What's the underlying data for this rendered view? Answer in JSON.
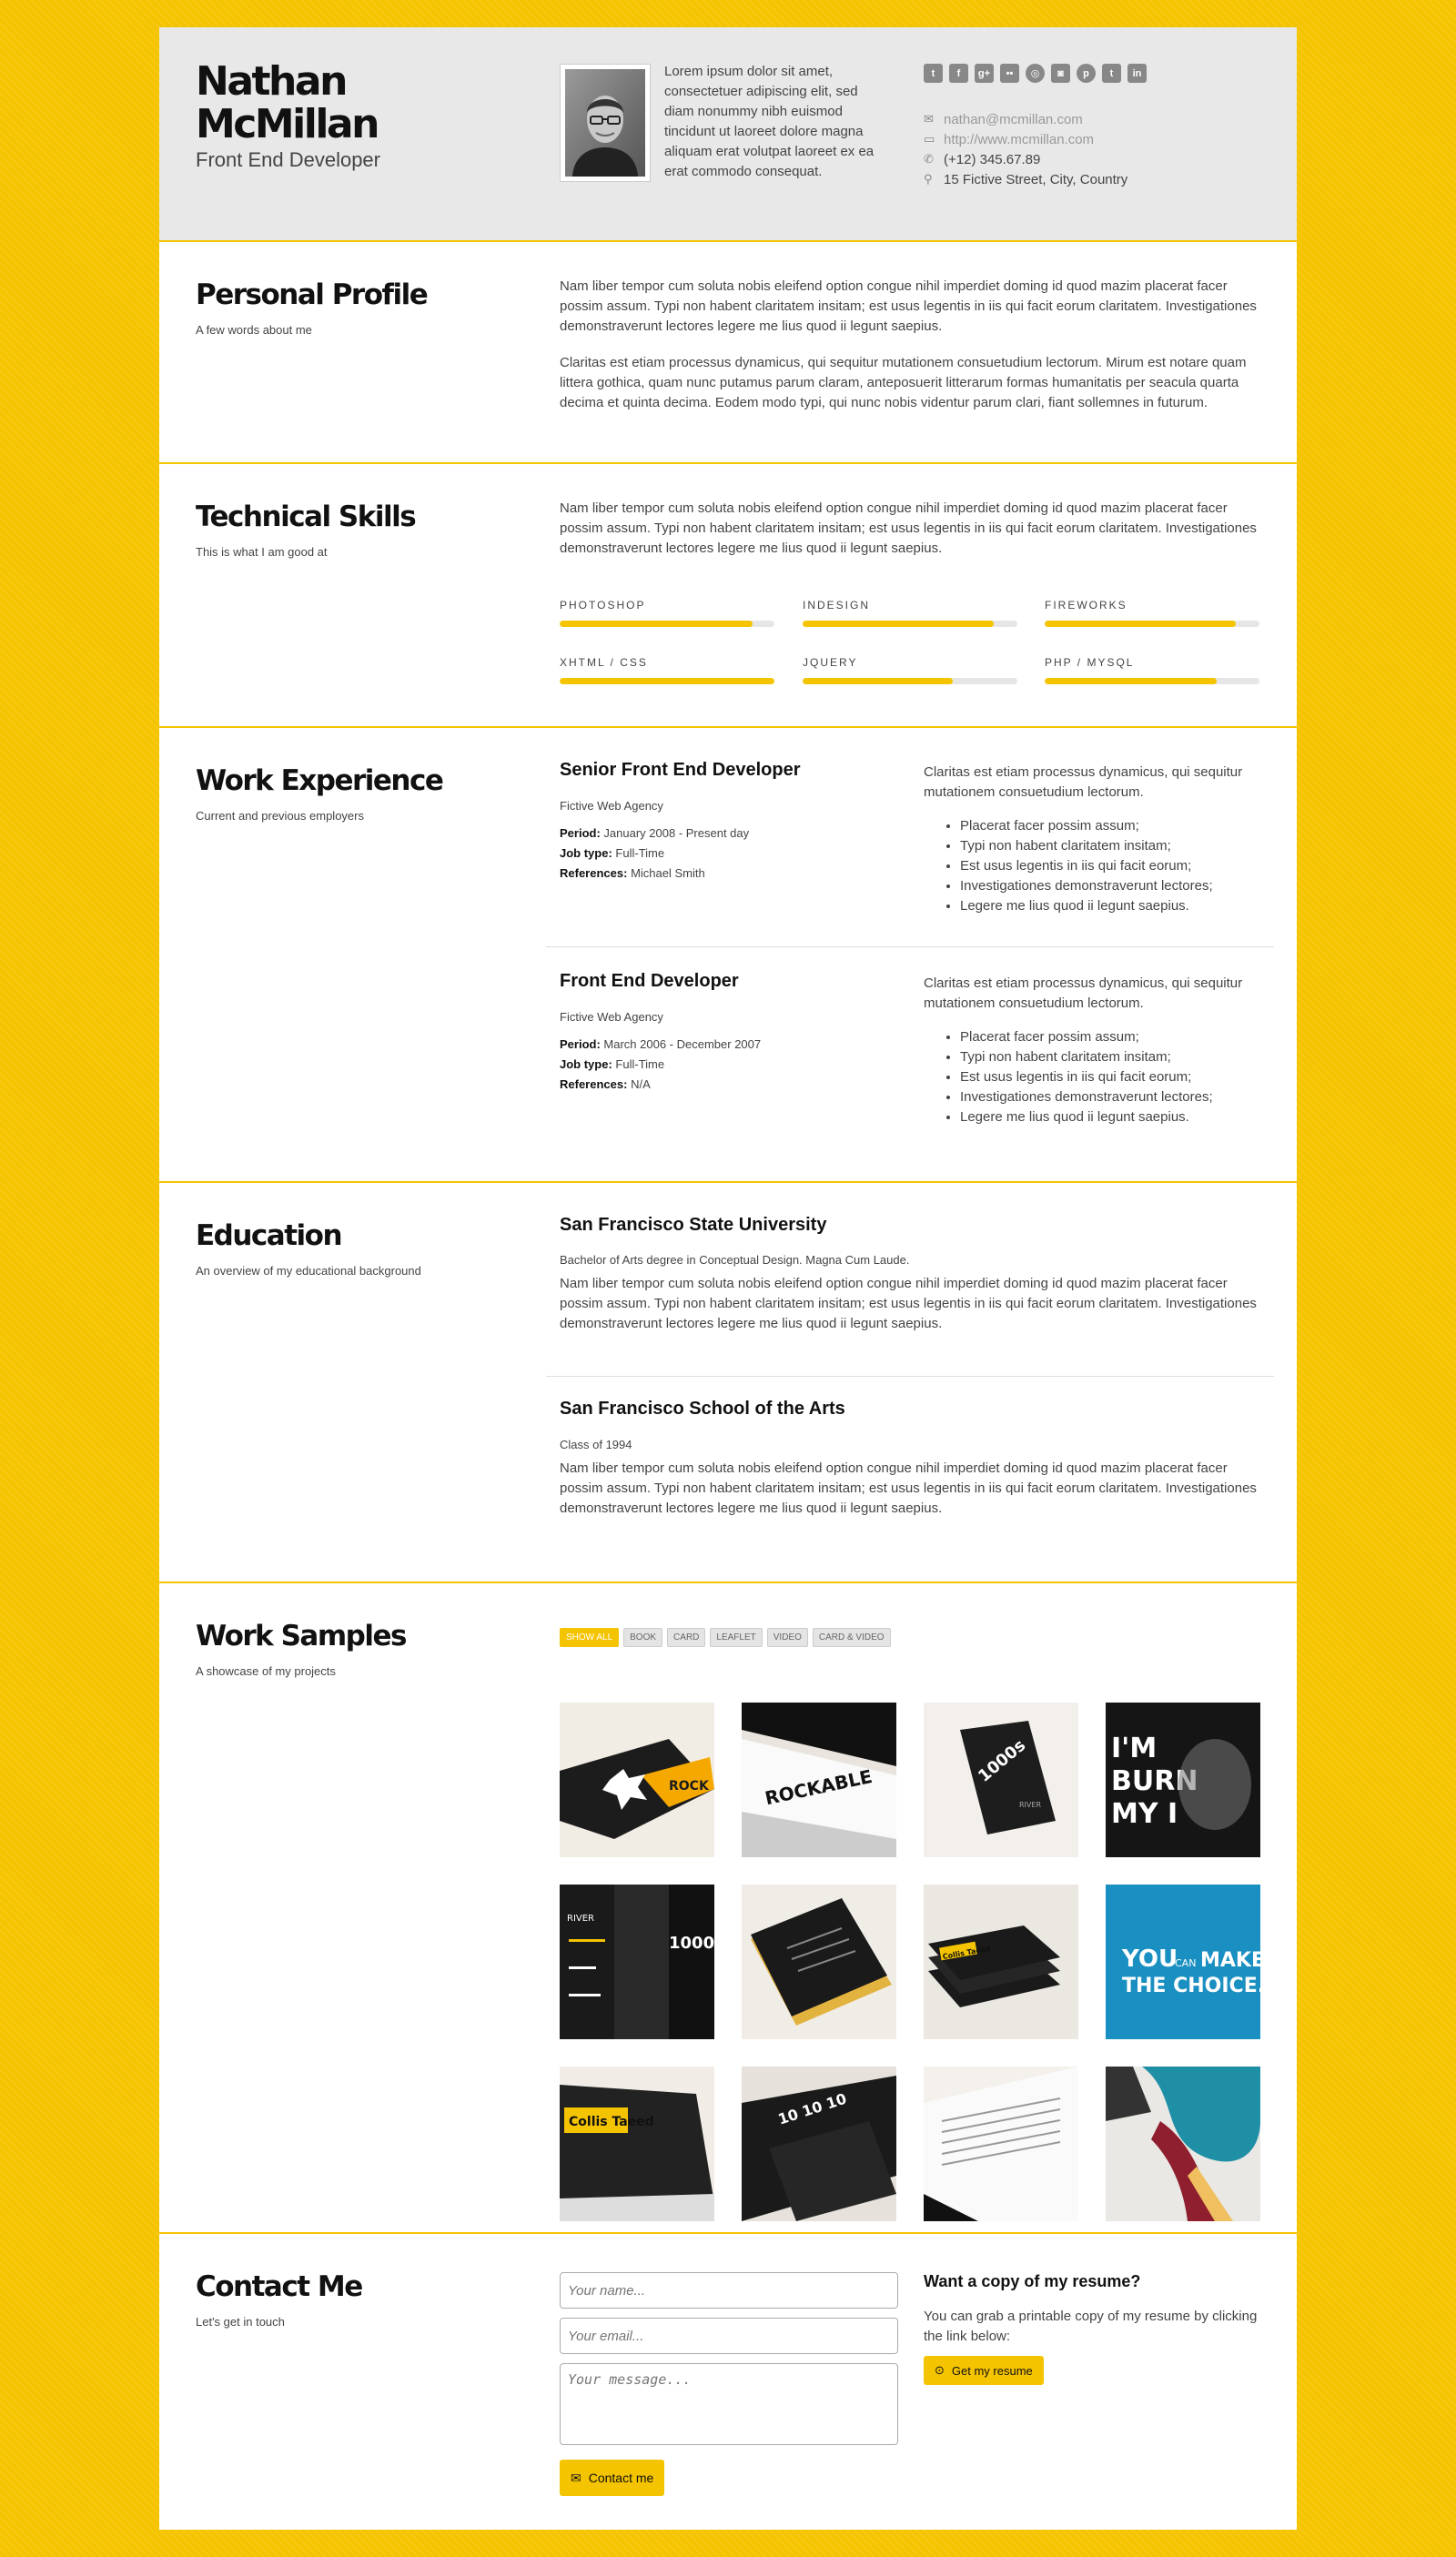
{
  "colors": {
    "accent": "#f5c400",
    "header_bg": "#e8e8e8"
  },
  "header": {
    "name": "Nathan McMillan",
    "role": "Front End Developer",
    "intro": "Lorem ipsum dolor sit amet, consectetuer adipiscing elit, sed diam nonummy nibh euismod tincidunt ut laoreet dolore magna aliquam erat volutpat laoreet ex ea erat commodo consequat.",
    "social_icons": [
      "twitter-icon",
      "facebook-icon",
      "google-plus-icon",
      "flickr-icon",
      "dribbble-icon",
      "instagram-icon",
      "pinterest-icon",
      "tumblr-icon",
      "linkedin-icon"
    ],
    "email": "nathan@mcmillan.com",
    "website": "http://www.mcmillan.com",
    "phone": "(+12) 345.67.89",
    "address": "15 Fictive Street, City, Country"
  },
  "profile": {
    "title": "Personal Profile",
    "subtitle": "A few words about me",
    "p1": "Nam liber tempor cum soluta nobis eleifend option congue nihil imperdiet doming id quod mazim placerat facer possim assum. Typi non habent claritatem insitam; est usus legentis in iis qui facit eorum claritatem. Investigationes demonstraverunt lectores legere me lius quod ii legunt saepius.",
    "p2": "Claritas est etiam processus dynamicus, qui sequitur mutationem consuetudium lectorum. Mirum est notare quam littera gothica, quam nunc putamus parum claram, anteposuerit litterarum formas humanitatis per seacula quarta decima et quinta decima. Eodem modo typi, qui nunc nobis videntur parum clari, fiant sollemnes in futurum."
  },
  "skills": {
    "title": "Technical Skills",
    "subtitle": "This is what I am good at",
    "text": "Nam liber tempor cum soluta nobis eleifend option congue nihil imperdiet doming id quod mazim placerat facer possim assum. Typi non habent claritatem insitam; est usus legentis in iis qui facit eorum claritatem. Investigationes demonstraverunt lectores legere me lius quod ii legunt saepius.",
    "items": [
      {
        "label": "PHOTOSHOP",
        "level": 0.9
      },
      {
        "label": "INDESIGN",
        "level": 0.89
      },
      {
        "label": "FIREWORKS",
        "level": 0.89
      },
      {
        "label": "XHTML / CSS",
        "level": 1.0
      },
      {
        "label": "JQUERY",
        "level": 0.7
      },
      {
        "label": "PHP / MYSQL",
        "level": 0.8
      }
    ]
  },
  "work": {
    "title": "Work Experience",
    "subtitle": "Current and previous employers",
    "period_label": "Period:",
    "jobtype_label": "Job type:",
    "refs_label": "References:",
    "jobs": [
      {
        "title": "Senior Front End Developer",
        "company": "Fictive Web Agency",
        "period": "January 2008 - Present day",
        "job_type": "Full-Time",
        "references": "Michael Smith",
        "desc": "Claritas est etiam processus dynamicus, qui sequitur mutationem consuetudium lectorum.",
        "bullets": [
          "Placerat facer possim assum;",
          "Typi non habent claritatem insitam;",
          "Est usus legentis in iis qui facit eorum;",
          "Investigationes demonstraverunt lectores;",
          "Legere me lius quod ii legunt saepius."
        ]
      },
      {
        "title": "Front End Developer",
        "company": "Fictive Web Agency",
        "period": "March 2006 - December 2007",
        "job_type": "Full-Time",
        "references": "N/A",
        "desc": "Claritas est etiam processus dynamicus, qui sequitur mutationem consuetudium lectorum.",
        "bullets": [
          "Placerat facer possim assum;",
          "Typi non habent claritatem insitam;",
          "Est usus legentis in iis qui facit eorum;",
          "Investigationes demonstraverunt lectores;",
          "Legere me lius quod ii legunt saepius."
        ]
      }
    ]
  },
  "education": {
    "title": "Education",
    "subtitle": "An overview of my educational background",
    "items": [
      {
        "school": "San Francisco State University",
        "degree": "Bachelor of Arts degree in Conceptual Design. Magna Cum Laude.",
        "text": "Nam liber tempor cum soluta nobis eleifend option congue nihil imperdiet doming id quod mazim placerat facer possim assum. Typi non habent claritatem insitam; est usus legentis in iis qui facit eorum claritatem. Investigationes demonstraverunt lectores legere me lius quod ii legunt saepius."
      },
      {
        "school": "San Francisco School of the Arts",
        "degree": "Class of 1994",
        "text": "Nam liber tempor cum soluta nobis eleifend option congue nihil imperdiet doming id quod mazim placerat facer possim assum. Typi non habent claritatem insitam; est usus legentis in iis qui facit eorum claritatem. Investigationes demonstraverunt lectores legere me lius quod ii legunt saepius."
      }
    ]
  },
  "samples": {
    "title": "Work Samples",
    "subtitle": "A showcase of my projects",
    "filters": [
      "SHOW ALL",
      "BOOK",
      "CARD",
      "LEAFLET",
      "VIDEO",
      "CARD & VIDEO"
    ],
    "tile_text": {
      "t1": "ROCK",
      "t2": "ROCKABLE",
      "t3": "1000s",
      "t3_sub": "RIVER",
      "t4": "I'M ON BURN MY I",
      "t5": "1000",
      "t5_sub": "RIVER",
      "t7": "Collis Taeed",
      "t8_you": "YOU",
      "t8_can": "CAN",
      "t8_make": "MAKE",
      "t8_choice": "THE CHOICE.",
      "t9": "Collis Taeed",
      "t10": "10 10 10"
    }
  },
  "contact": {
    "title": "Contact Me",
    "subtitle": "Let's get in touch",
    "name_placeholder": "Your name...",
    "email_placeholder": "Your email...",
    "message_placeholder": "Your message...",
    "submit_label": "Contact me",
    "resume_heading": "Want a copy of my resume?",
    "resume_text": "You can grab a printable copy of my resume by clicking the link below:",
    "resume_button": "Get my resume"
  }
}
